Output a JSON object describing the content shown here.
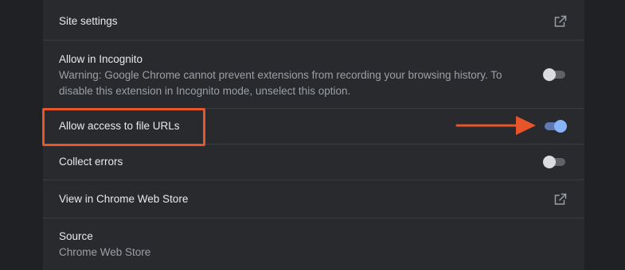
{
  "rows": {
    "site_settings": {
      "label": "Site settings",
      "icon": "open-in-new-icon"
    },
    "incognito": {
      "label": "Allow in Incognito",
      "description": "Warning: Google Chrome cannot prevent extensions from recording your browsing history. To disable this extension in Incognito mode, unselect this option.",
      "enabled": false
    },
    "file_urls": {
      "label": "Allow access to file URLs",
      "enabled": true
    },
    "collect_errors": {
      "label": "Collect errors",
      "enabled": false
    },
    "web_store": {
      "label": "View in Chrome Web Store",
      "icon": "open-in-new-icon"
    },
    "source": {
      "label": "Source",
      "value": "Chrome Web Store"
    }
  },
  "annotations": {
    "highlight_color": "#e8552a",
    "arrow_color": "#e8552a"
  },
  "colors": {
    "page_background": "#202124",
    "panel_background": "#292a2d",
    "toggle_on": "#8ab4f8",
    "toggle_off": "#dadce0"
  }
}
